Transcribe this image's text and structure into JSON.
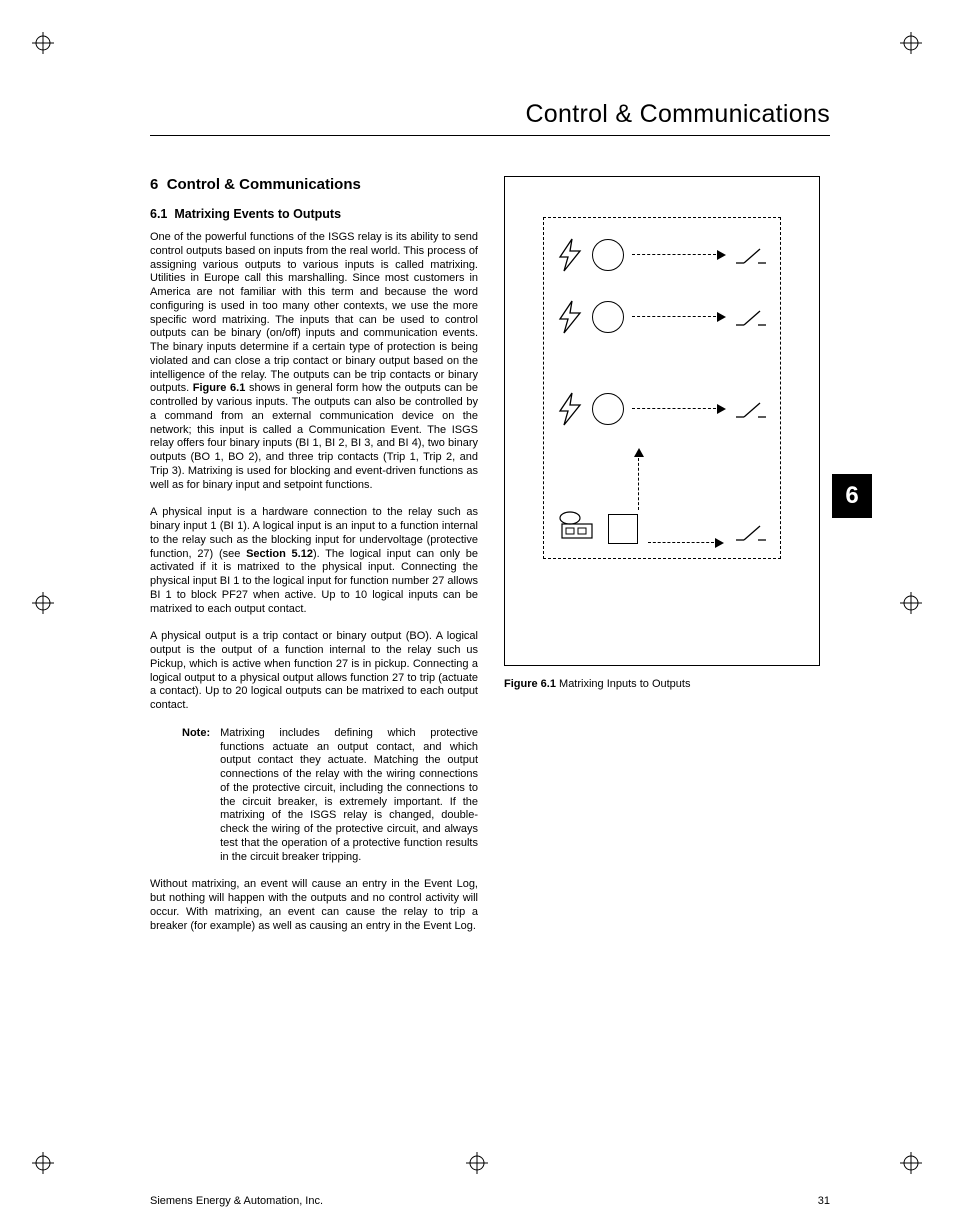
{
  "header": {
    "title": "Control & Communications"
  },
  "chapter_tab": "6",
  "section": {
    "number": "6",
    "title": "Control & Communications",
    "sub_number": "6.1",
    "sub_title": "Matrixing Events to Outputs"
  },
  "paragraphs": {
    "p1a": "One of the powerful functions of the ISGS relay is its ability to send control outputs based on inputs from the real world. This process of assigning various outputs to various inputs is called matrixing. Utilities in Europe call this marshalling. Since most customers in America are not familiar with this term and because the word configuring is used in too many other contexts, we use the more specific word matrixing. The inputs that can be used to control outputs can be binary (on/off) inputs and communication events. The binary inputs determine if a certain type of protection is being violated and can close a trip contact or binary output based on the intelligence of the relay. The outputs can be trip contacts or binary outputs. ",
    "p1b_bold": "Figure 6.1",
    "p1c": " shows in general form how the outputs can be controlled by various inputs. The outputs can also be controlled by a command from an external communication device on the network; this input is called a Communication Event. The ISGS relay offers four binary inputs (BI 1, BI 2, BI 3, and BI 4), two binary outputs (BO 1, BO 2), and three trip contacts (Trip 1, Trip 2, and Trip 3). Matrixing is used for blocking and event-driven functions as well as for binary input and setpoint functions.",
    "p2a": "A physical input is a hardware connection to the relay such as binary input 1 (BI 1). A logical input is an input to a function internal to the relay such as the blocking input for undervoltage (protective function, 27) (see ",
    "p2b_bold": "Section 5.12",
    "p2c": "). The logical input can only be activated if it is matrixed to the physical input. Connecting the physical input BI 1 to the logical input for function number 27 allows BI 1 to block PF27 when active. Up to 10 logical inputs can be matrixed to each output contact.",
    "p3": "A physical output is a trip contact or binary output (BO). A logical output is the output of a function internal to the relay such us Pickup, which is active when function 27 is in pickup. Connecting a logical output to a physical output allows function 27 to trip (actuate a contact). Up to 20 logical outputs can be matrixed to each output contact.",
    "note_label": "Note:",
    "note_body": "Matrixing includes defining which protective functions actuate an output contact, and which output contact they actuate. Matching the output connections of the relay with the wiring connections of the protective circuit, including the connections to the circuit breaker, is extremely important. If the matrixing of the ISGS relay is changed, double-check the wiring of the protective circuit, and always test that the operation of a protective function results in the circuit breaker tripping.",
    "p4": "Without matrixing, an event will cause an entry in the Event Log, but nothing will happen with the outputs and no control activity will occur. With matrixing, an event can cause the relay to trip a breaker (for example) as well as causing an entry in the Event Log."
  },
  "figure": {
    "label": "Figure 6.1",
    "caption": " Matrixing Inputs to Outputs"
  },
  "footer": {
    "company": "Siemens Energy & Automation, Inc.",
    "page": "31"
  }
}
